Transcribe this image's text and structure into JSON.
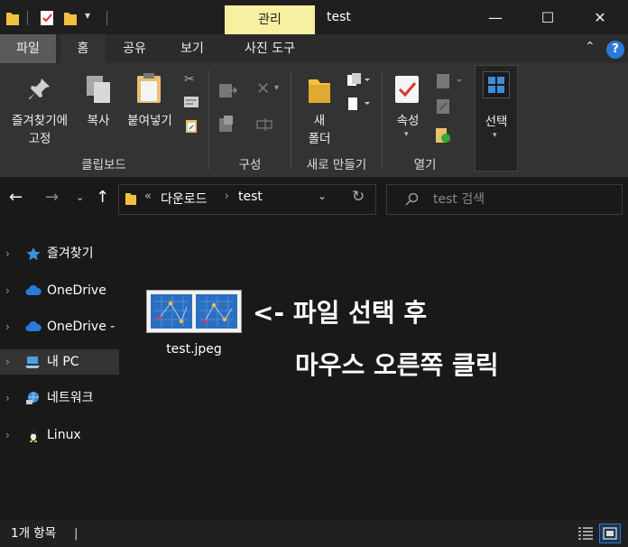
{
  "window": {
    "title": "test",
    "context_tab": "관리",
    "controls": {
      "minimize": "—",
      "maximize": "☐",
      "close": "✕"
    }
  },
  "ribbon_tabs": [
    "파일",
    "홈",
    "공유",
    "보기",
    "사진 도구"
  ],
  "ribbon": {
    "pin_label_line1": "즐겨찾기에",
    "pin_label_line2": "고정",
    "copy": "복사",
    "paste": "붙여넣기",
    "new_folder_line1": "새",
    "new_folder_line2": "폴더",
    "properties": "속성",
    "select": "선택",
    "groups": {
      "clipboard": "클립보드",
      "organize": "구성",
      "new": "새로 만들기",
      "open": "열기"
    }
  },
  "address": {
    "overflow": "«",
    "path": [
      "다운로드",
      "test"
    ],
    "search_placeholder": "test 검색"
  },
  "nav": {
    "items": [
      {
        "label": "즐겨찾기",
        "icon": "star-icon"
      },
      {
        "label": "OneDrive",
        "icon": "cloud-icon"
      },
      {
        "label": "OneDrive -",
        "icon": "cloud-icon"
      },
      {
        "label": "내 PC",
        "icon": "pc-icon",
        "selected": true
      },
      {
        "label": "네트워크",
        "icon": "network-icon"
      },
      {
        "label": "Linux",
        "icon": "penguin-icon"
      }
    ]
  },
  "content": {
    "file_name": "test.jpeg",
    "annotation_line1": "<- 파일 선택 후",
    "annotation_line2": "마우스 오른쪽 클릭"
  },
  "status": {
    "item_count": "1개 항목",
    "cursor": "|"
  },
  "colors": {
    "accent": "#2a7bd6",
    "context_tab": "#f7f0a0",
    "selected_nav": "#333333"
  }
}
